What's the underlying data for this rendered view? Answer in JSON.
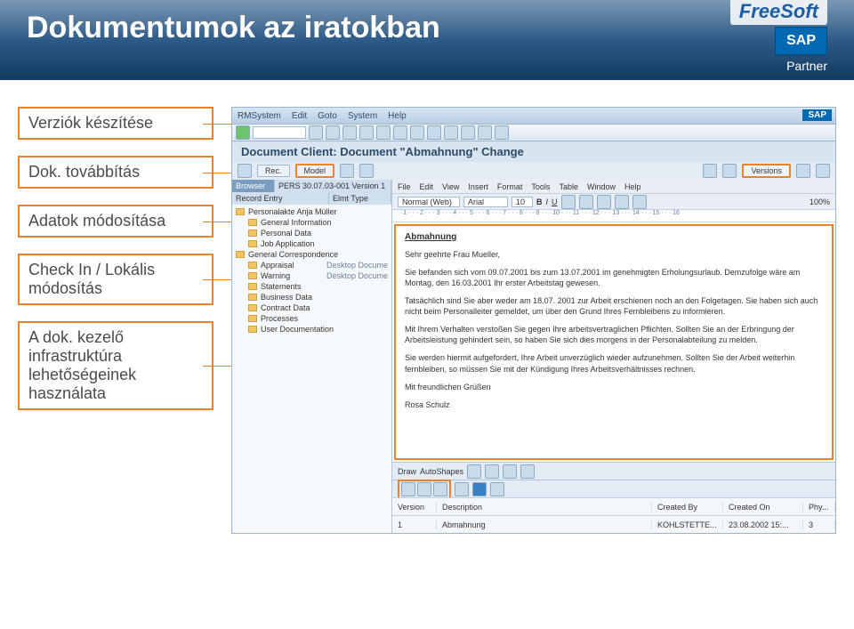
{
  "slide": {
    "title": "Dokumentumok az iratokban"
  },
  "logos": {
    "brand": "FreeSoft",
    "sap": "SAP",
    "partner": "Partner"
  },
  "callouts": [
    "Verziók készítése",
    "Dok. továbbítás",
    "Adatok módosítása",
    "Check In / Lokális módosítás",
    "A dok. kezelő infrastruktúra lehetőségeinek használata"
  ],
  "sap": {
    "menu": [
      "RMSystem",
      "Edit",
      "Goto",
      "System",
      "Help"
    ],
    "doc_title": "Document Client: Document \"Abmahnung\" Change",
    "subbar": {
      "rec": "Rec.",
      "model": "Model",
      "versions": "Versions"
    },
    "tree": {
      "browser_label": "Browser",
      "browser_value": "PERS 30.07.03-001 Version 1",
      "col1": "Record Entry",
      "col2": "Elmt Type",
      "items": [
        {
          "label": "Personalakte Anja Müller",
          "level": 1
        },
        {
          "label": "General Information",
          "level": 2
        },
        {
          "label": "Personal Data",
          "level": 2
        },
        {
          "label": "Job Application",
          "level": 2
        },
        {
          "label": "General Correspondence",
          "level": 1
        },
        {
          "label": "Appraisal",
          "level": 2,
          "type": "Desktop Docume"
        },
        {
          "label": "Warning",
          "level": 2,
          "type": "Desktop Docume"
        },
        {
          "label": "Statements",
          "level": 2
        },
        {
          "label": "Business Data",
          "level": 2
        },
        {
          "label": "Contract Data",
          "level": 2
        },
        {
          "label": "Processes",
          "level": 2
        },
        {
          "label": "User Documentation",
          "level": 2
        }
      ]
    },
    "editor_menu": [
      "File",
      "Edit",
      "View",
      "Insert",
      "Format",
      "Tools",
      "Table",
      "Window",
      "Help"
    ],
    "editor_tools": {
      "style": "Normal (Web)",
      "font": "Arial",
      "size": "10"
    },
    "ruler": "· 1 · · · 2 · · · 3 · · · 4 · · · 5 · · · 6 · · · 7 · · · 8 · · · 9 · · · 10 · · · 11 · · · 12 · · · 13 · · · 14 · · · 15 · · · 16",
    "letter": {
      "heading": "Abmahnung",
      "p1": "Sehr geehrte Frau Mueller,",
      "p2": "Sie befanden sich vom 09.07.2001 bis zum 13.07.2001 im genehmigten Erholungsurlaub. Demzufolge wäre am Montag, den 16.03.2001 Ihr erster Arbeitstag gewesen.",
      "p3": "Tatsächlich sind Sie aber weder am 18.07. 2001 zur Arbeit erschienen noch an den Folgetagen. Sie haben sich auch nicht beim Personalleiter gemeldet, um über den Grund Ihres Fernbleibens zu informieren.",
      "p4": "Mit Ihrem Verhalten verstoßen Sie gegen Ihre arbeitsvertraglichen Pflichten. Sollten Sie an der Erbringung der Arbeitsleistung gehindert sein, so haben Sie sich dies morgens in der Personalabteilung zu melden.",
      "p5": "Sie werden hiermit aufgefordert, Ihre Arbeit unverzüglich wieder aufzunehmen. Sollten Sie der Arbeit weiterhin fernbleiben, so müssen Sie mit der Kündigung Ihres Arbeitsverhältnisses rechnen.",
      "p6": "Mit freundlichen Grüßen",
      "p7": "Rosa Schulz"
    },
    "grid": {
      "h_version": "Version",
      "h_desc": "Description",
      "h_by": "Created By",
      "h_on": "Created On",
      "h_phy": "Phy...",
      "r_version": "1",
      "r_desc": "Abmahnung",
      "r_by": "KOHLSTETTE...",
      "r_on": "23.08.2002 15:...",
      "r_phy": "3",
      "draw": "Draw",
      "autoshapes": "AutoShapes"
    }
  },
  "footer": ""
}
